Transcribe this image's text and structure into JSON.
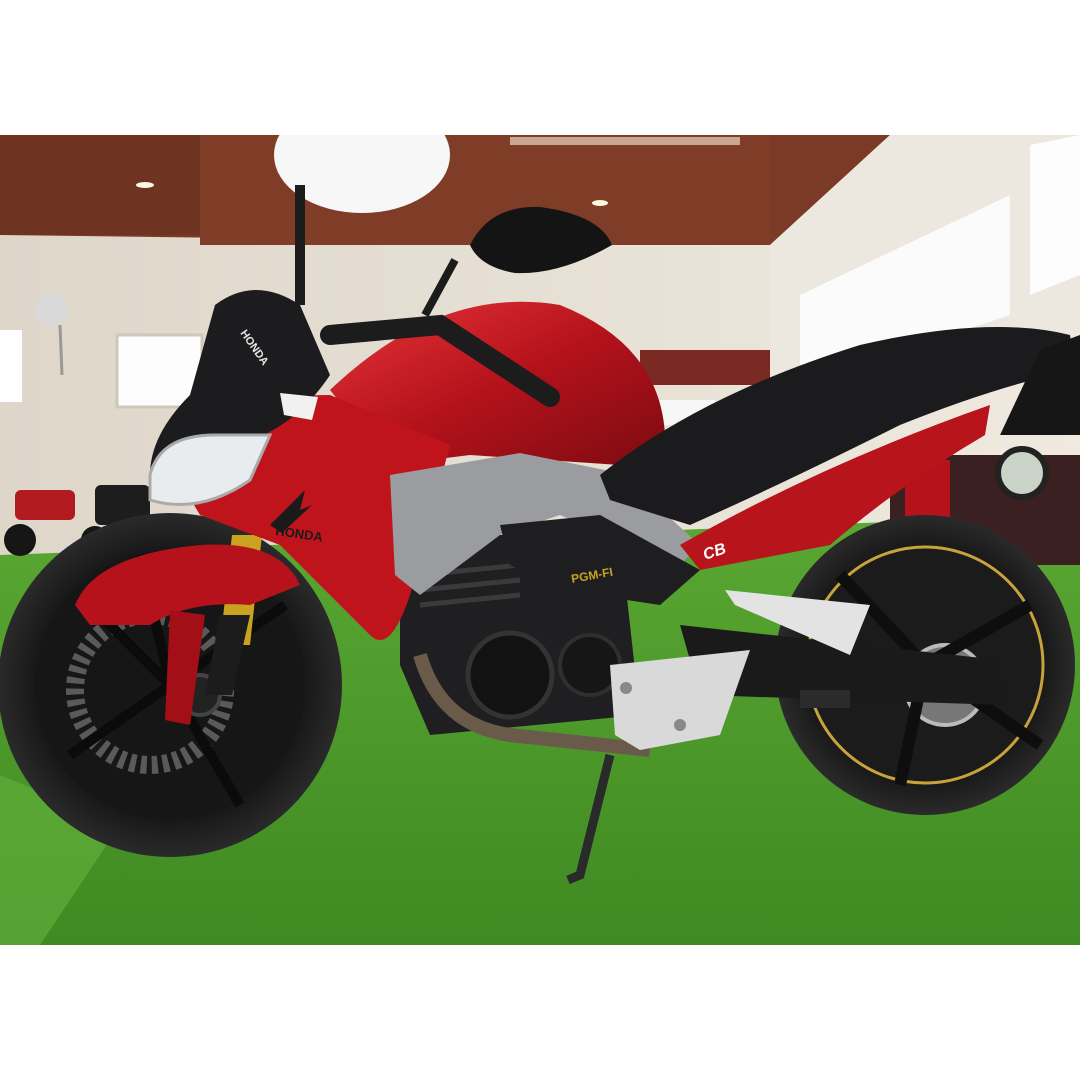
{
  "image": {
    "subject": "motorcycle-side-view",
    "colors": {
      "background": "#ffffff",
      "body_red": "#b5121b",
      "body_red_light": "#d8242c",
      "panel_silver": "#9a9c9f",
      "seat_black": "#1b1b1d",
      "grass_green": "#4c9a2a",
      "ceiling_brown": "#7a3a26",
      "wall_beige": "#e6ded2",
      "fork_gold": "#c9a21f"
    },
    "text": {
      "tank_brand": "HONDA",
      "shroud_brand": "HONDA",
      "side_badge": "PGM-FI",
      "tail_model": "CB"
    }
  }
}
